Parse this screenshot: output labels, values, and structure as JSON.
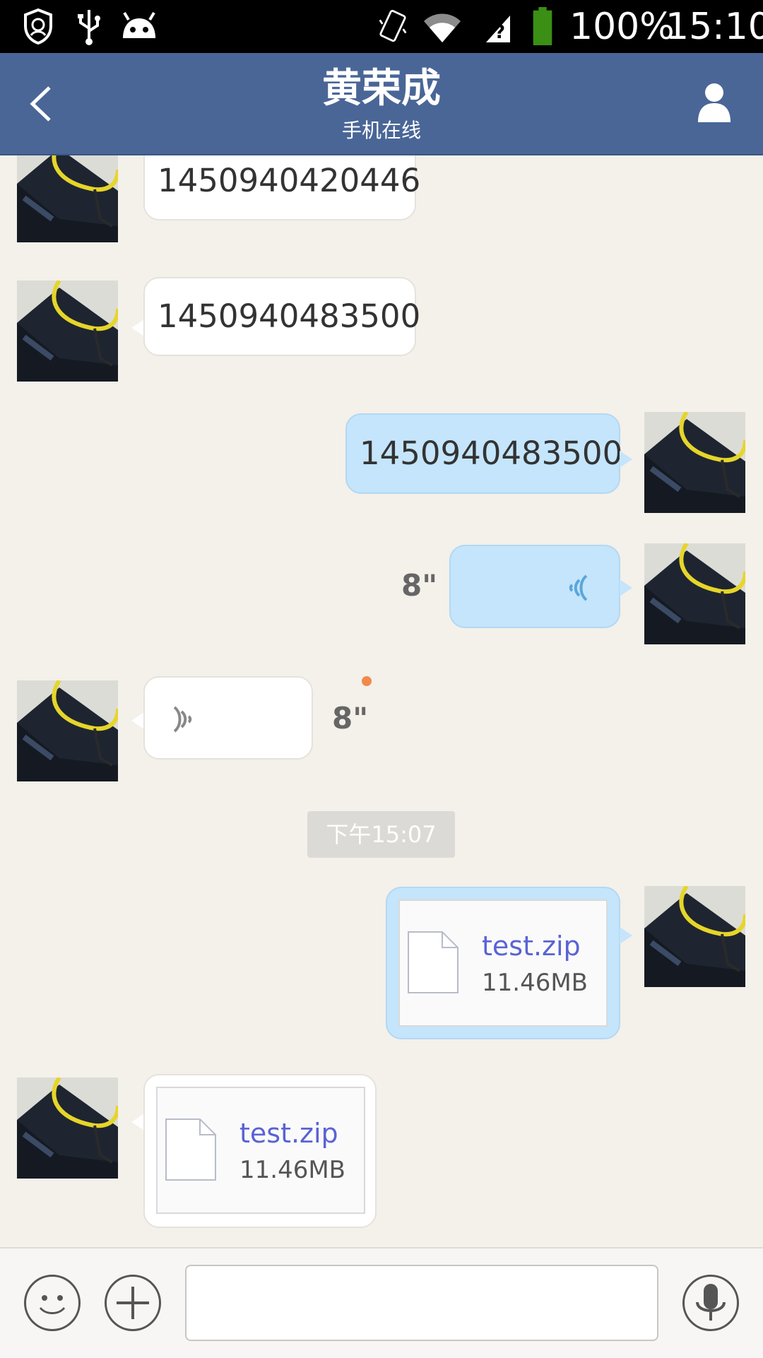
{
  "status_bar": {
    "battery": "100%",
    "time": "15:10",
    "icons": [
      "shield-icon",
      "usb-icon",
      "android-icon",
      "vibrate-icon",
      "wifi-icon",
      "sim-icon",
      "battery-icon"
    ]
  },
  "header": {
    "title": "黄荣成",
    "subtitle": "手机在线"
  },
  "messages": [
    {
      "side": "in",
      "type": "text",
      "text": "1450940420446"
    },
    {
      "side": "in",
      "type": "text",
      "text": "1450940483500"
    },
    {
      "side": "out",
      "type": "text",
      "text": "1450940483500"
    },
    {
      "side": "out",
      "type": "voice",
      "duration": "8\""
    },
    {
      "side": "in",
      "type": "voice",
      "duration": "8\"",
      "unread": true
    },
    {
      "type": "timestamp",
      "text": "下午15:07"
    },
    {
      "side": "out",
      "type": "file",
      "file_name": "test.zip",
      "file_size": "11.46MB"
    },
    {
      "side": "in",
      "type": "file",
      "file_name": "test.zip",
      "file_size": "11.46MB"
    }
  ],
  "input_bar": {
    "text_value": "",
    "icons": [
      "emoji-icon",
      "plus-icon",
      "microphone-icon"
    ]
  },
  "colors": {
    "header": "#4a6697",
    "bubble_out": "#c4e5fb",
    "bubble_in": "#ffffff",
    "file_link": "#5a63d3",
    "unread_dot": "#f08a4b",
    "background": "#f4f0ea"
  }
}
